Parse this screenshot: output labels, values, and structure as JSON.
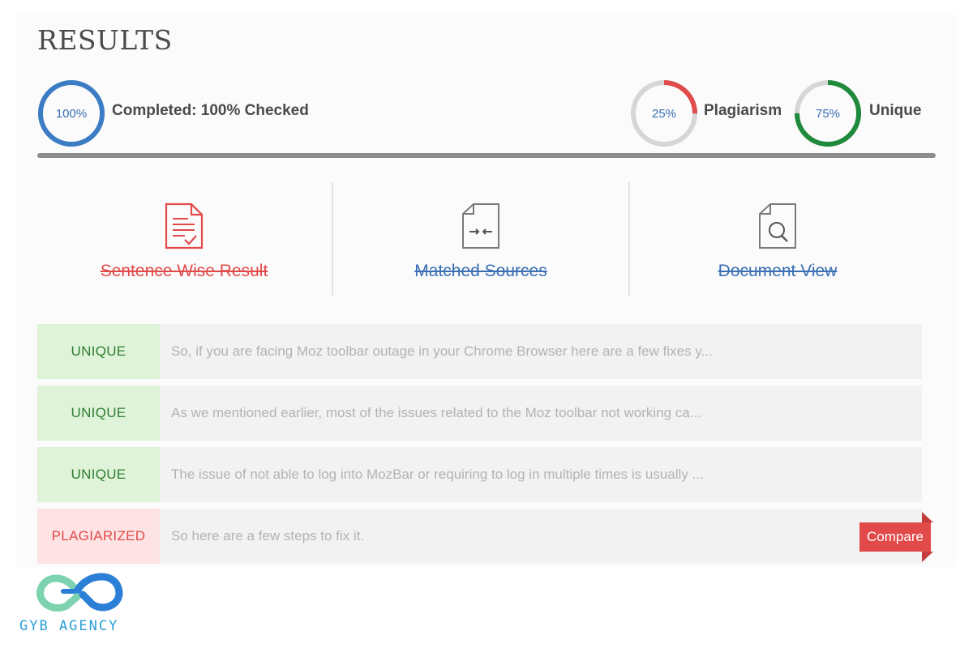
{
  "header": {
    "title": "RESULTS"
  },
  "progress": {
    "completed": {
      "value": "100%",
      "label": "Completed: 100% Checked",
      "fraction": 1.0,
      "color": "#3c7cc4"
    },
    "plagiarism": {
      "value": "25%",
      "label": "Plagiarism",
      "fraction": 0.25,
      "color": "#e04b4b"
    },
    "unique": {
      "value": "75%",
      "label": "Unique",
      "fraction": 0.75,
      "color": "#1f8a3c"
    }
  },
  "tabs": [
    {
      "label": "Sentence Wise Result",
      "icon": "document-check-icon",
      "color": "#e24a4a"
    },
    {
      "label": "Matched Sources",
      "icon": "document-compare-icon",
      "color": "#3a6fb3"
    },
    {
      "label": "Document View",
      "icon": "document-search-icon",
      "color": "#3a6fb3"
    }
  ],
  "results": [
    {
      "status": "UNIQUE",
      "text": "So, if you are facing Moz toolbar outage in your Chrome Browser here are a few fixes y..."
    },
    {
      "status": "UNIQUE",
      "text": "As we mentioned earlier, most of the issues related to the Moz toolbar not working ca..."
    },
    {
      "status": "UNIQUE",
      "text": "The issue of not able to log into MozBar or requiring to log in multiple times is usually ..."
    },
    {
      "status": "PLAGIARIZED",
      "text": "So here are a few steps to fix it."
    }
  ],
  "compare_label": "Compare",
  "branding": {
    "name": "GYB AGENCY"
  },
  "colors": {
    "unique_bg": "#dff3d8",
    "unique_text": "#2e7d32",
    "plag_bg": "#fde3e3",
    "plag_text": "#e24a4a"
  }
}
